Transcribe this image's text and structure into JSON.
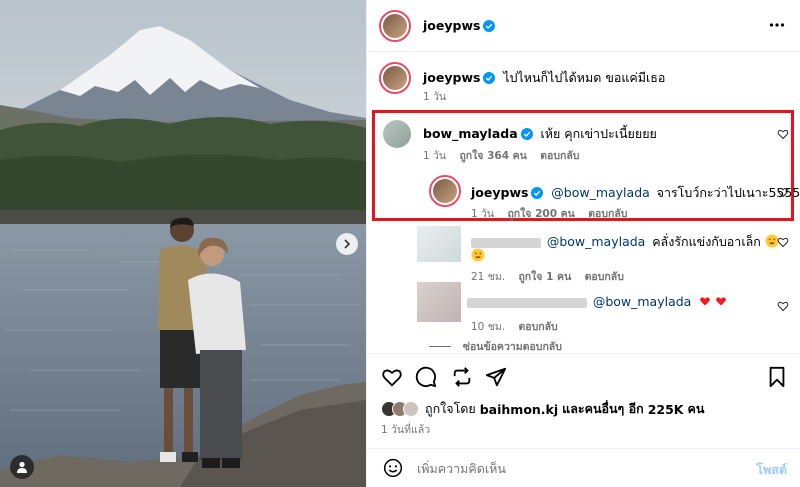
{
  "post": {
    "author": "joeypws",
    "caption": "ไปไหนก็ไปได้หมด ขอแค่มีเธอ",
    "caption_time": "1 วัน"
  },
  "comments": [
    {
      "user": "bow_maylada",
      "text": "เห้ย คุกเข่าปะเนี้ยยยย",
      "time": "1 วัน",
      "likes": "ถูกใจ 364 คน",
      "reply": "ตอบกลับ"
    },
    {
      "user": "joeypws",
      "mention": "@bow_maylada",
      "text": "จารโบว์กะว่าไปเนาะ55555",
      "time": "1 วัน",
      "likes": "ถูกใจ 200 คน",
      "reply": "ตอบกลับ"
    },
    {
      "mention": "@bow_maylada",
      "text": "คลั่งรักแข่งกับอาเล็ก",
      "time": "21 ชม.",
      "likes": "ถูกใจ 1 คน",
      "reply": "ตอบกลับ"
    },
    {
      "mention": "@bow_maylada",
      "time": "10 ชม.",
      "reply": "ตอบกลับ"
    }
  ],
  "hide_replies": "ซ่อนข้อความตอบกลับ",
  "likes_summary": {
    "prefix": "ถูกใจโดย",
    "user": "baihmon.kj",
    "middle": "และคนอื่นๆ อีก",
    "count": "225K",
    "suffix": "คน"
  },
  "posted_time": "1 วันที่แล้ว",
  "composer": {
    "placeholder": "เพิ่มความคิดเห็น",
    "post_label": "โพสต์"
  },
  "colors": {
    "verified": "#0095f6",
    "highlight": "#e3161f",
    "mention": "#00376b",
    "heart": "#ed1c24",
    "post_button": "#9ecbf6"
  }
}
